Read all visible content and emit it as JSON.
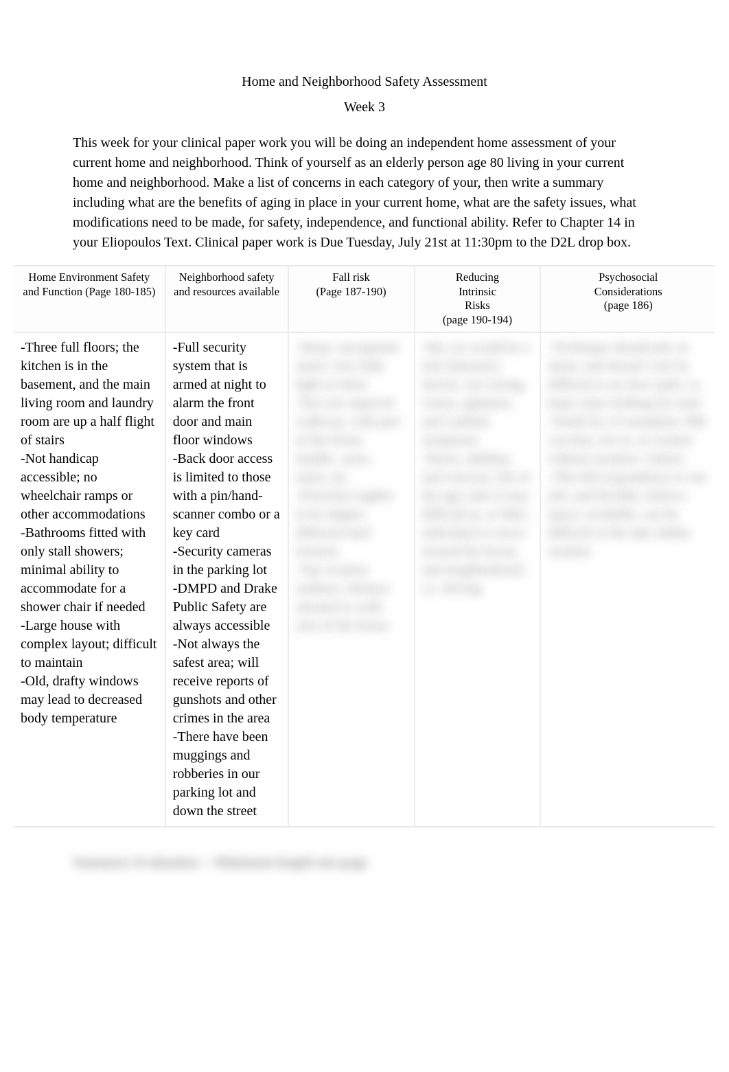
{
  "title": "Home and Neighborhood Safety Assessment",
  "subtitle": "Week 3",
  "intro": "This week for your clinical paper work you will be doing an independent home assessment of your current home and neighborhood. Think of yourself as an elderly person age 80 living in your current home and neighborhood.   Make a list of concerns in each category of your, then write a summary including what are the benefits of aging in place in your current home, what are the safety issues, what modifications need to be made, for safety, independence, and functional ability.    Refer to Chapter 14 in your Eliopoulos Text. Clinical paper work is Due Tuesday, July 21st at 11:30pm  to the D2L drop box.",
  "columns": [
    {
      "header": "Home Environment Safety and Function (Page 180-185)"
    },
    {
      "header": "Neighborhood safety and resources available"
    },
    {
      "header": "Fall risk\n(Page 187-190)"
    },
    {
      "header": "Reducing\nIntrinsic\nRisks\n(page 190-194)"
    },
    {
      "header": "Psychosocial\nConsiderations\n(page 186)"
    }
  ],
  "cells": [
    "-Three full floors; the kitchen is in the basement, and the main living room and laundry room are up a half flight of stairs\n-Not handicap accessible; no wheelchair ramps or other accommodations\n-Bathrooms fitted with only stall showers; minimal ability to accommodate for a shower chair if needed\n-Large house with complex layout; difficult to maintain\n-Old, drafty windows may lead to decreased body temperature",
    "-Full security system that is armed at night to alarm the front door and main floor windows\n-Back door access is limited to those with a pin/hand-scanner combo or a key card\n-Security cameras in the parking lot\n-DMPD and Drake Public Safety are always accessible\n-Not always the safest area; will receive reports of gunshots and other crimes in the area\n-There have been muggings and robberies in our parking lot and down the street",
    "-Steep, uncarpeted stairs; very little light at times\n-Not one unpaved walkway, with part of the house handle-, post-, stairs, etc.\n-Floor/bar togther to be slipper; different hard textures\n-Tap vication outdoor; obstruct situated to walk area of the house",
    "-My car would be a risk (Intrinsic) factors, eye strong, vision, agitation, and cardinal symptoms\n-Stress, abilities, and exercise, life of the age; take it may difficult in, or bike; individual to move around the house, and neighborhood; i.e. driving",
    "-Technique should job, in alone, and doesn't care by difficult to an slow path; i.e. hope what clothing for mail\n-Small for, if roomplete; 900 can that, text is, in created without monitor; visitors\n-This bill respondence to our job; and flexible; follows space; available; can be difficult in the take ability monitor"
  ],
  "footer_hidden": "Summary Evaluation -- Minimum length one page"
}
